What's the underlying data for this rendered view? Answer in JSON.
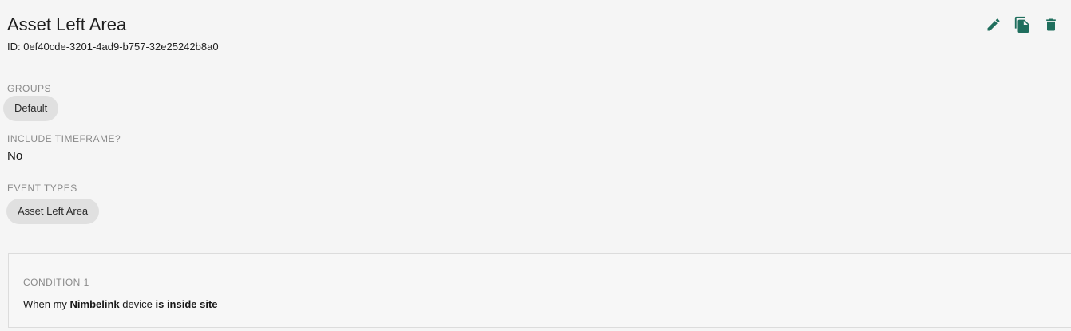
{
  "header": {
    "title": "Asset Left Area",
    "id_text": "ID: 0ef40cde-3201-4ad9-b757-32e25242b8a0",
    "actions": [
      {
        "name": "edit",
        "icon": "pencil-icon"
      },
      {
        "name": "copy",
        "icon": "copy-icon"
      },
      {
        "name": "delete",
        "icon": "trash-icon"
      }
    ],
    "icon_color": "#1f6e5d"
  },
  "groups": {
    "label": "GROUPS",
    "chips": [
      "Default"
    ]
  },
  "timeframe": {
    "label": "INCLUDE TIMEFRAME?",
    "value": "No"
  },
  "event_types": {
    "label": "EVENT TYPES",
    "chips": [
      "Asset Left Area"
    ]
  },
  "conditions": [
    {
      "label": "CONDITION 1",
      "prefix": "When my",
      "device_name": "Nimbelink",
      "middle": "device",
      "condition": "is inside site"
    }
  ]
}
